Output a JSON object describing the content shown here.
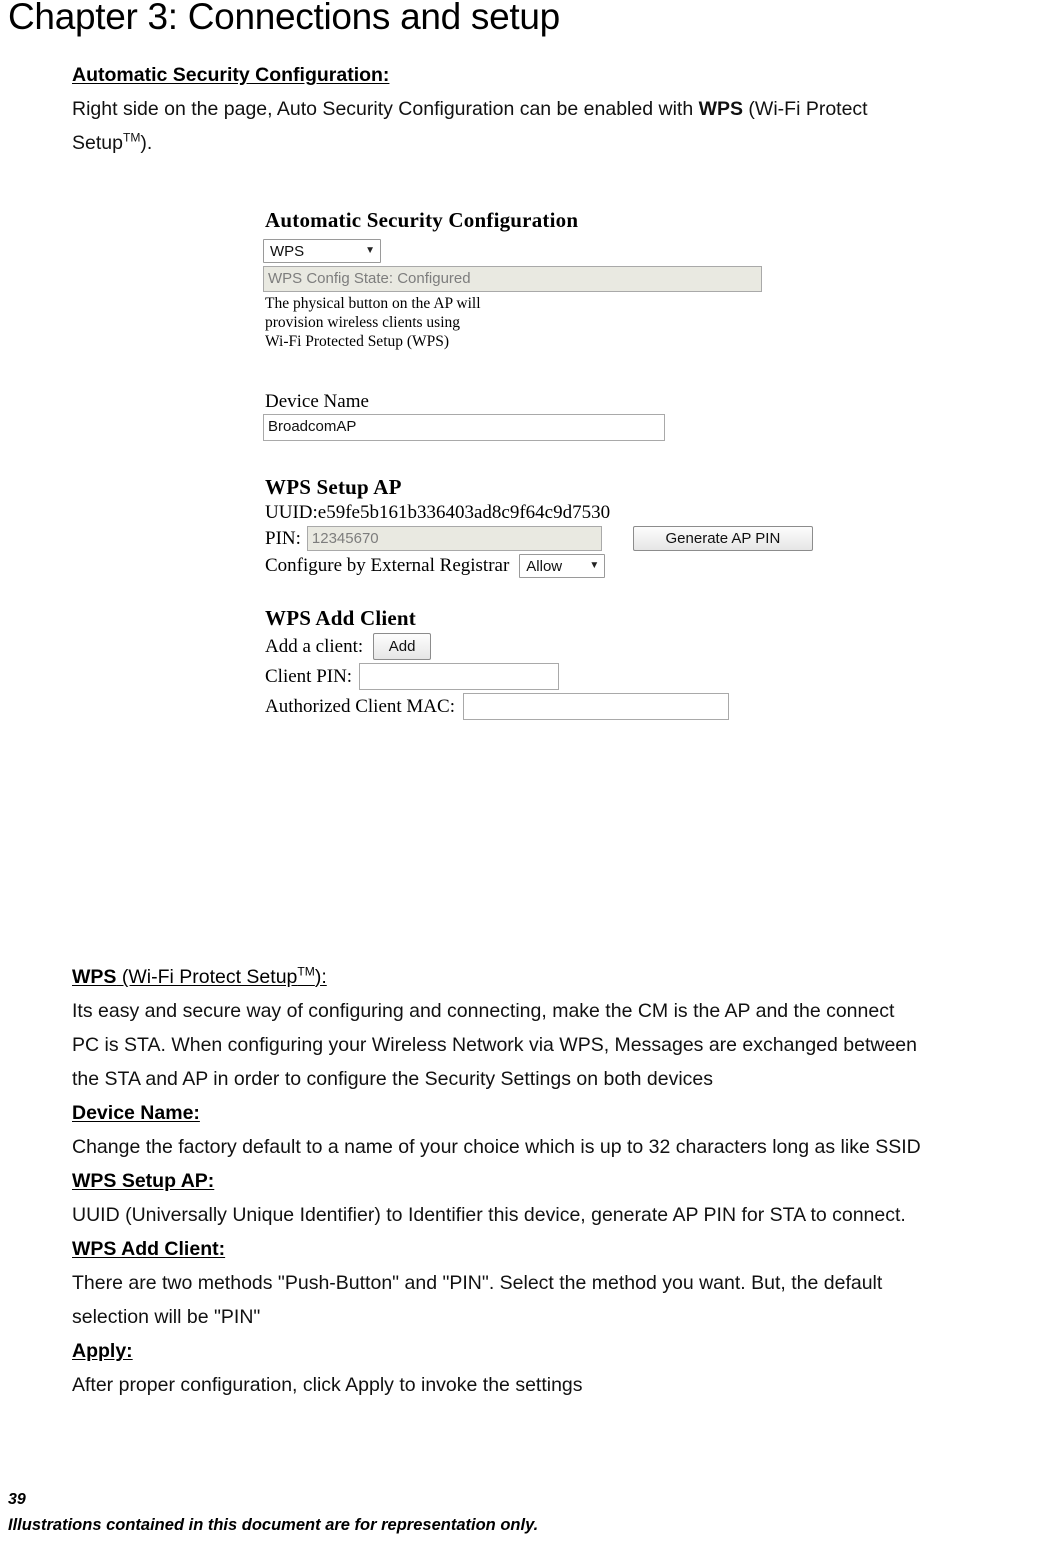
{
  "page": {
    "chapter_title": "Chapter 3: Connections and setup",
    "page_number": "39",
    "footer_note": "Illustrations contained in this document are for representation only."
  },
  "intro": {
    "heading": "Automatic Security Configuration:",
    "line1_before": "Right side on the page, Auto Security Configuration can be enabled with ",
    "line1_bold": "WPS",
    "line1_after": " (Wi-Fi Protect",
    "line2_before": "Setup",
    "line2_tm": "TM",
    "line2_after": ")."
  },
  "screenshot": {
    "title": "Automatic Security Configuration",
    "mode_select": {
      "value": "WPS",
      "caret": "chevron-down-icon"
    },
    "config_state": "WPS Config State: Configured",
    "note_lines": [
      "The physical button on the AP will",
      "provision wireless clients using",
      "Wi-Fi Protected Setup (WPS)"
    ],
    "device_name": {
      "label": "Device Name",
      "value": "BroadcomAP"
    },
    "setup_ap": {
      "title": "WPS Setup AP",
      "uuid_label": "UUID:",
      "uuid_value": "e59fe5b161b336403ad8c9f64c9d7530",
      "pin_label": "PIN:",
      "pin_value": "12345670",
      "generate_button": "Generate AP PIN",
      "registrar_label": "Configure by External Registrar",
      "registrar_value": "Allow"
    },
    "add_client": {
      "title": "WPS Add Client",
      "add_label": "Add a client:",
      "add_button": "Add",
      "client_pin_label": "Client PIN:",
      "client_pin_value": "",
      "client_mac_label": "Authorized Client MAC:",
      "client_mac_value": ""
    }
  },
  "sections": [
    {
      "heading_bold": "WPS",
      "heading_plain_before": " (Wi-Fi Protect Setup",
      "heading_tm": "TM",
      "heading_plain_after": "):",
      "body": [
        "Its easy and secure way of configuring and connecting, make the CM is the AP and the connect",
        "PC is STA. When configuring your Wireless Network via WPS, Messages are exchanged between",
        "the STA and AP in order to configure the Security Settings on both devices"
      ]
    },
    {
      "heading": "Device Name:",
      "body": [
        "Change the factory default to a name of your choice which is up to 32 characters long as like SSID"
      ]
    },
    {
      "heading": "WPS Setup AP:",
      "body": [
        "UUID (Universally Unique Identifier) to Identifier this device, generate AP PIN for STA to connect."
      ]
    },
    {
      "heading": "WPS Add Client:",
      "body": [
        "There are two methods \"Push-Button\" and \"PIN\". Select the method you want. But, the default",
        "selection will be \"PIN\""
      ]
    },
    {
      "heading": "Apply:",
      "body": [
        "After proper configuration, click Apply to invoke the settings"
      ]
    }
  ]
}
